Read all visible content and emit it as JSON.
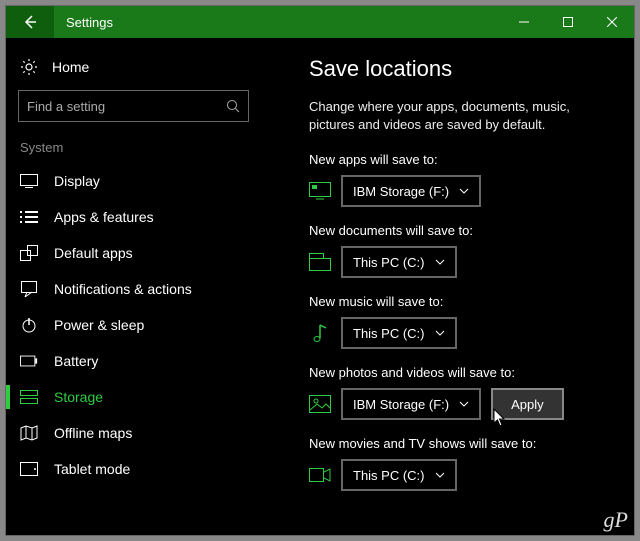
{
  "window": {
    "title": "Settings"
  },
  "sidebar": {
    "home": "Home",
    "search_placeholder": "Find a setting",
    "category": "System",
    "items": [
      {
        "label": "Display"
      },
      {
        "label": "Apps & features"
      },
      {
        "label": "Default apps"
      },
      {
        "label": "Notifications & actions"
      },
      {
        "label": "Power & sleep"
      },
      {
        "label": "Battery"
      },
      {
        "label": "Storage"
      },
      {
        "label": "Offline maps"
      },
      {
        "label": "Tablet mode"
      }
    ]
  },
  "main": {
    "heading": "Save locations",
    "description": "Change where your apps, documents, music, pictures and videos are saved by default.",
    "apply_label": "Apply",
    "settings": [
      {
        "label": "New apps will save to:",
        "value": "IBM Storage (F:)"
      },
      {
        "label": "New documents will save to:",
        "value": "This PC (C:)"
      },
      {
        "label": "New music will save to:",
        "value": "This PC (C:)"
      },
      {
        "label": "New photos and videos will save to:",
        "value": "IBM Storage (F:)"
      },
      {
        "label": "New movies and TV shows will save to:",
        "value": "This PC (C:)"
      }
    ]
  },
  "watermark": "gP",
  "colors": {
    "accent": "#2ecc40",
    "titlebar": "#1a7a1a"
  }
}
